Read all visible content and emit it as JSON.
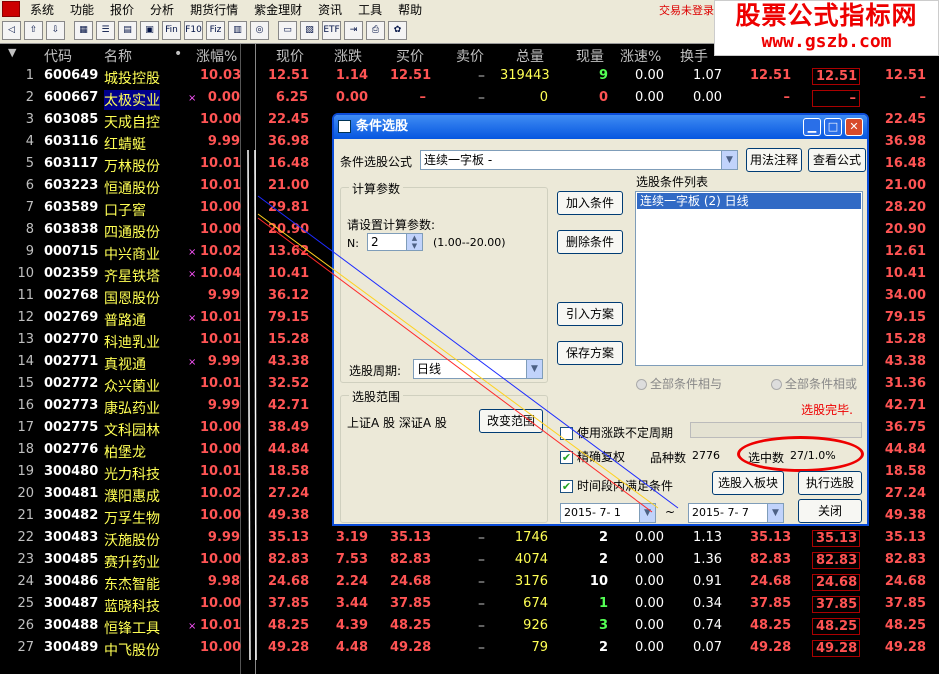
{
  "menu": {
    "items": [
      "系统",
      "功能",
      "报价",
      "分析",
      "期货行情",
      "紫金理财",
      "资讯",
      "工具",
      "帮助"
    ],
    "login_status": "交易未登录"
  },
  "watermark": {
    "line1": "股票公式指标网",
    "line2": "www.gszb.com"
  },
  "toolbar": {
    "icons": [
      "back-icon",
      "up-icon",
      "down-icon",
      "grid-icon",
      "list-icon",
      "table-icon",
      "panel-icon",
      "fin-icon",
      "f10-icon",
      "fiz-icon",
      "chart-icon",
      "circle-icon",
      "folder-icon",
      "block-icon",
      "etf-icon",
      "export-icon",
      "print-icon",
      "settings-icon"
    ],
    "labels": [
      "",
      "",
      "",
      "",
      "",
      "",
      "",
      "Fin",
      "F10",
      "Fiz",
      "",
      "",
      "",
      "",
      "ETF",
      "",
      "",
      ""
    ]
  },
  "table": {
    "headers": [
      "代码",
      "名称",
      "•",
      "涨幅%",
      "现价",
      "涨跌",
      "买价",
      "卖价",
      "总量",
      "现量",
      "涨速%",
      "换手"
    ],
    "rows": [
      {
        "idx": "1",
        "code": "600649",
        "name": "城投控股",
        "x": "",
        "pct": "10.03",
        "price": "12.51",
        "chg": "1.14",
        "buy": "12.51",
        "sell": "–",
        "vol": "319443",
        "cur": "9",
        "cur_color": "#54ff54",
        "spd": "0.00",
        "turn": "1.07",
        "p2": "12.51",
        "p3": "12.51",
        "p4": "12.51"
      },
      {
        "idx": "2",
        "code": "600667",
        "name": "太极实业",
        "x": "×",
        "pct": "0.00",
        "price": "6.25",
        "chg": "0.00",
        "buy": "–",
        "sell": "–",
        "vol": "0",
        "cur": "0",
        "cur_color": "#ff5454",
        "spd": "0.00",
        "turn": "0.00",
        "p2": "–",
        "p3": "–",
        "p4": "–",
        "sel": true
      },
      {
        "idx": "3",
        "code": "603085",
        "name": "天成自控",
        "x": "",
        "pct": "10.00",
        "price": "22.45",
        "chg": "",
        "buy": "",
        "sell": "",
        "vol": "",
        "cur": "",
        "spd": "",
        "turn": "",
        "p2": "",
        "p3": "",
        "p4": "22.45"
      },
      {
        "idx": "4",
        "code": "603116",
        "name": "红蜻蜓",
        "x": "",
        "pct": "9.99",
        "price": "36.98",
        "chg": "",
        "buy": "",
        "sell": "",
        "vol": "",
        "cur": "",
        "spd": "",
        "turn": "",
        "p2": "",
        "p3": "",
        "p4": "36.98"
      },
      {
        "idx": "5",
        "code": "603117",
        "name": "万林股份",
        "x": "",
        "pct": "10.01",
        "price": "16.48",
        "chg": "",
        "buy": "",
        "sell": "",
        "vol": "",
        "cur": "",
        "spd": "",
        "turn": "",
        "p2": "",
        "p3": "",
        "p4": "16.48"
      },
      {
        "idx": "6",
        "code": "603223",
        "name": "恒通股份",
        "x": "",
        "pct": "10.01",
        "price": "21.00",
        "chg": "",
        "buy": "",
        "sell": "",
        "vol": "",
        "cur": "",
        "spd": "",
        "turn": "",
        "p2": "",
        "p3": "",
        "p4": "21.00"
      },
      {
        "idx": "7",
        "code": "603589",
        "name": "口子窖",
        "x": "",
        "pct": "10.00",
        "price": "29.81",
        "chg": "",
        "buy": "",
        "sell": "",
        "vol": "",
        "cur": "",
        "spd": "",
        "turn": "",
        "p2": "",
        "p3": "",
        "p4": "28.20"
      },
      {
        "idx": "8",
        "code": "603838",
        "name": "四通股份",
        "x": "",
        "pct": "10.00",
        "price": "20.90",
        "chg": "",
        "buy": "",
        "sell": "",
        "vol": "",
        "cur": "",
        "spd": "",
        "turn": "",
        "p2": "",
        "p3": "",
        "p4": "20.90"
      },
      {
        "idx": "9",
        "code": "000715",
        "name": "中兴商业",
        "x": "×",
        "pct": "10.02",
        "price": "13.62",
        "chg": "",
        "buy": "",
        "sell": "",
        "vol": "",
        "cur": "",
        "spd": "",
        "turn": "",
        "p2": "",
        "p3": "",
        "p4": "12.61"
      },
      {
        "idx": "10",
        "code": "002359",
        "name": "齐星铁塔",
        "x": "×",
        "pct": "10.04",
        "price": "10.41",
        "chg": "",
        "buy": "",
        "sell": "",
        "vol": "",
        "cur": "",
        "spd": "",
        "turn": "",
        "p2": "",
        "p3": "",
        "p4": "10.41"
      },
      {
        "idx": "11",
        "code": "002768",
        "name": "国恩股份",
        "x": "",
        "pct": "9.99",
        "price": "36.12",
        "chg": "",
        "buy": "",
        "sell": "",
        "vol": "",
        "cur": "",
        "spd": "",
        "turn": "",
        "p2": "",
        "p3": "",
        "p4": "34.00"
      },
      {
        "idx": "12",
        "code": "002769",
        "name": "普路通",
        "x": "×",
        "pct": "10.01",
        "price": "79.15",
        "chg": "",
        "buy": "",
        "sell": "",
        "vol": "",
        "cur": "",
        "spd": "",
        "turn": "",
        "p2": "",
        "p3": "",
        "p4": "79.15"
      },
      {
        "idx": "13",
        "code": "002770",
        "name": "科迪乳业",
        "x": "",
        "pct": "10.01",
        "price": "15.28",
        "chg": "",
        "buy": "",
        "sell": "",
        "vol": "",
        "cur": "",
        "spd": "",
        "turn": "",
        "p2": "",
        "p3": "",
        "p4": "15.28"
      },
      {
        "idx": "14",
        "code": "002771",
        "name": "真视通",
        "x": "×",
        "pct": "9.99",
        "price": "43.38",
        "chg": "",
        "buy": "",
        "sell": "",
        "vol": "",
        "cur": "",
        "spd": "",
        "turn": "",
        "p2": "",
        "p3": "",
        "p4": "43.38"
      },
      {
        "idx": "15",
        "code": "002772",
        "name": "众兴菌业",
        "x": "",
        "pct": "10.01",
        "price": "32.52",
        "chg": "",
        "buy": "",
        "sell": "",
        "vol": "",
        "cur": "",
        "spd": "",
        "turn": "",
        "p2": "",
        "p3": "",
        "p4": "31.36"
      },
      {
        "idx": "16",
        "code": "002773",
        "name": "康弘药业",
        "x": "",
        "pct": "9.99",
        "price": "42.71",
        "chg": "",
        "buy": "",
        "sell": "",
        "vol": "",
        "cur": "",
        "spd": "",
        "turn": "",
        "p2": "",
        "p3": "",
        "p4": "42.71"
      },
      {
        "idx": "17",
        "code": "002775",
        "name": "文科园林",
        "x": "",
        "pct": "10.00",
        "price": "38.49",
        "chg": "",
        "buy": "",
        "sell": "",
        "vol": "",
        "cur": "",
        "spd": "",
        "turn": "",
        "p2": "",
        "p3": "",
        "p4": "36.75"
      },
      {
        "idx": "18",
        "code": "002776",
        "name": "柏堡龙",
        "x": "",
        "pct": "10.00",
        "price": "44.84",
        "chg": "",
        "buy": "",
        "sell": "",
        "vol": "",
        "cur": "",
        "spd": "",
        "turn": "",
        "p2": "",
        "p3": "",
        "p4": "44.84"
      },
      {
        "idx": "19",
        "code": "300480",
        "name": "光力科技",
        "x": "",
        "pct": "10.01",
        "price": "18.58",
        "chg": "",
        "buy": "",
        "sell": "",
        "vol": "",
        "cur": "",
        "spd": "",
        "turn": "",
        "p2": "",
        "p3": "",
        "p4": "18.58"
      },
      {
        "idx": "20",
        "code": "300481",
        "name": "濮阳惠成",
        "x": "",
        "pct": "10.02",
        "price": "27.24",
        "chg": "",
        "buy": "",
        "sell": "",
        "vol": "",
        "cur": "",
        "spd": "",
        "turn": "",
        "p2": "",
        "p3": "",
        "p4": "27.24"
      },
      {
        "idx": "21",
        "code": "300482",
        "name": "万孚生物",
        "x": "",
        "pct": "10.00",
        "price": "49.38",
        "chg": "",
        "buy": "",
        "sell": "",
        "vol": "",
        "cur": "",
        "spd": "",
        "turn": "",
        "p2": "",
        "p3": "",
        "p4": "49.38"
      },
      {
        "idx": "22",
        "code": "300483",
        "name": "沃施股份",
        "x": "",
        "pct": "9.99",
        "price": "35.13",
        "chg": "3.19",
        "buy": "35.13",
        "sell": "–",
        "vol": "1746",
        "cur": "2",
        "cur_color": "#fff",
        "spd": "0.00",
        "turn": "1.13",
        "p2": "35.13",
        "p3": "35.13",
        "p4": "35.13"
      },
      {
        "idx": "23",
        "code": "300485",
        "name": "赛升药业",
        "x": "",
        "pct": "10.00",
        "price": "82.83",
        "chg": "7.53",
        "buy": "82.83",
        "sell": "–",
        "vol": "4074",
        "cur": "2",
        "cur_color": "#fff",
        "spd": "0.00",
        "turn": "1.36",
        "p2": "82.83",
        "p3": "82.83",
        "p4": "82.83"
      },
      {
        "idx": "24",
        "code": "300486",
        "name": "东杰智能",
        "x": "",
        "pct": "9.98",
        "price": "24.68",
        "chg": "2.24",
        "buy": "24.68",
        "sell": "–",
        "vol": "3176",
        "cur": "10",
        "cur_color": "#fff",
        "spd": "0.00",
        "turn": "0.91",
        "p2": "24.68",
        "p3": "24.68",
        "p4": "24.68"
      },
      {
        "idx": "25",
        "code": "300487",
        "name": "蓝晓科技",
        "x": "",
        "pct": "10.00",
        "price": "37.85",
        "chg": "3.44",
        "buy": "37.85",
        "sell": "–",
        "vol": "674",
        "cur": "1",
        "cur_color": "#54ff54",
        "spd": "0.00",
        "turn": "0.34",
        "p2": "37.85",
        "p3": "37.85",
        "p4": "37.85"
      },
      {
        "idx": "26",
        "code": "300488",
        "name": "恒锋工具",
        "x": "×",
        "pct": "10.01",
        "price": "48.25",
        "chg": "4.39",
        "buy": "48.25",
        "sell": "–",
        "vol": "926",
        "cur": "3",
        "cur_color": "#54ff54",
        "spd": "0.00",
        "turn": "0.74",
        "p2": "48.25",
        "p3": "48.25",
        "p4": "48.25"
      },
      {
        "idx": "27",
        "code": "300489",
        "name": "中飞股份",
        "x": "",
        "pct": "10.00",
        "price": "49.28",
        "chg": "4.48",
        "buy": "49.28",
        "sell": "–",
        "vol": "79",
        "cur": "2",
        "cur_color": "#fff",
        "spd": "0.00",
        "turn": "0.07",
        "p2": "49.28",
        "p3": "49.28",
        "p4": "49.28"
      }
    ]
  },
  "dialog": {
    "title": "条件选股",
    "formula_label": "条件选股公式",
    "formula_value": "连续一字板 -",
    "usage_btn": "用法注释",
    "view_btn": "查看公式",
    "params_group": "计算参数",
    "params_prompt": "请设置计算参数:",
    "param_n_label": "N:",
    "param_n_value": "2",
    "param_range": "(1.00--20.00)",
    "period_label": "选股周期:",
    "period_value": "日线",
    "scope_group": "选股范围",
    "scope_text": "上证A 股  深证A 股",
    "change_scope_btn": "改变范围",
    "add_cond_btn": "加入条件",
    "del_cond_btn": "删除条件",
    "import_plan_btn": "引入方案",
    "save_plan_btn": "保存方案",
    "cond_list_label": "选股条件列表",
    "cond_list_items": [
      "连续一字板 (2) 日线"
    ],
    "radio_and": "全部条件相与",
    "radio_or": "全部条件相或",
    "status_done": "选股完毕.",
    "chk_uncertain": "使用涨跌不定周期",
    "chk_exact": "精确复权",
    "varieties_label": "品种数",
    "varieties_value": "2776",
    "selected_label": "选中数",
    "selected_value": "27/1.0%",
    "chk_period": "时间段内满足条件",
    "to_block_btn": "选股入板块",
    "execute_btn": "执行选股",
    "date_from": "2015- 7- 1",
    "date_to": "2015- 7- 7",
    "close_btn": "关闭"
  }
}
